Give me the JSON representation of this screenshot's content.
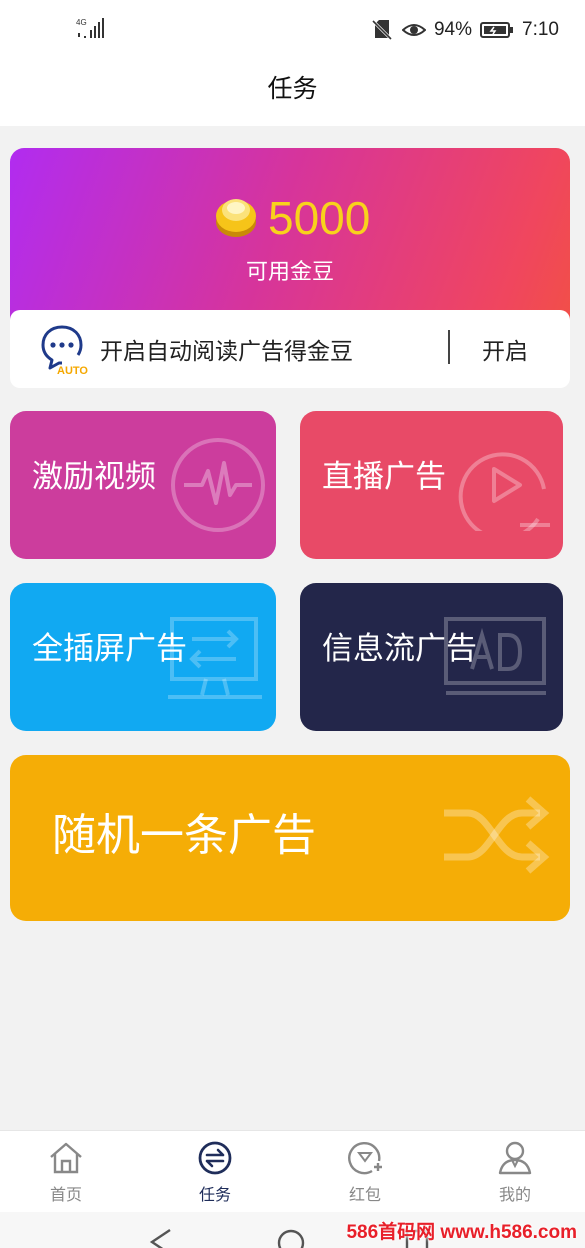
{
  "status_bar": {
    "network": "4G",
    "battery_percent": "94%",
    "time": "7:10",
    "icons": [
      "signal-icon",
      "no-sim-icon",
      "eye-icon",
      "battery-icon"
    ]
  },
  "header": {
    "title": "任务"
  },
  "balance": {
    "amount": "5000",
    "label": "可用金豆",
    "coin_color": "#f8d21c"
  },
  "auto_read": {
    "icon_badge": "AUTO",
    "text": "开启自动阅读广告得金豆",
    "button_label": "开启"
  },
  "tasks": [
    {
      "label": "激励视频",
      "color": "#cc3d9d",
      "icon": "pulse-icon"
    },
    {
      "label": "直播广告",
      "color": "#e84a67",
      "icon": "play-icon"
    },
    {
      "label": "全插屏广告",
      "color": "#11a9f2",
      "icon": "monitor-icon"
    },
    {
      "label": "信息流广告",
      "color": "#23264a",
      "icon": "ad-monitor-icon"
    },
    {
      "label": "随机一条广告",
      "color": "#f5ad06",
      "icon": "shuffle-icon"
    }
  ],
  "tab_bar": {
    "items": [
      {
        "label": "首页",
        "icon": "home-icon",
        "active": false
      },
      {
        "label": "任务",
        "icon": "exchange-icon",
        "active": true
      },
      {
        "label": "红包",
        "icon": "redpacket-icon",
        "active": false
      },
      {
        "label": "我的",
        "icon": "user-icon",
        "active": false
      }
    ]
  },
  "watermark": "586首码网 www.h586.com"
}
